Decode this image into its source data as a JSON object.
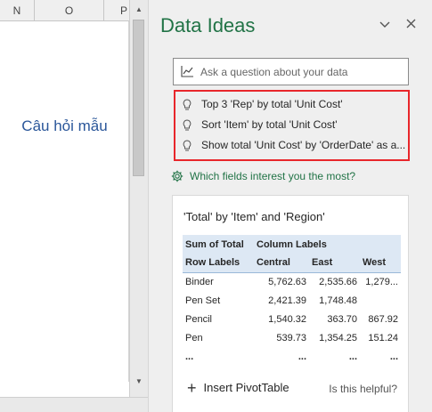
{
  "sheet": {
    "columns": [
      "N",
      "O",
      "P"
    ],
    "center_text": "Câu hỏi mẫu"
  },
  "pane": {
    "title": "Data Ideas",
    "collapse_icon": "chevron-down-icon",
    "close_icon": "close-icon",
    "ask_placeholder": "Ask a question about your data",
    "ask_icon": "chart-line-icon",
    "suggestions": [
      "Top 3 'Rep' by total 'Unit Cost'",
      "Sort 'Item' by total 'Unit Cost'",
      "Show total 'Unit Cost' by 'OrderDate' as a..."
    ],
    "suggestion_icon": "lightbulb-icon",
    "fields_link": "Which fields interest you the most?",
    "fields_icon": "gear-icon",
    "highlight_color": "#e8262b",
    "accent_color": "#217346"
  },
  "card": {
    "title": "'Total' by 'Item' and 'Region'",
    "header_row1": [
      "Sum of Total",
      "Column Labels",
      "",
      ""
    ],
    "header_row2": [
      "Row Labels",
      "Central",
      "East",
      "West"
    ],
    "rows": [
      [
        "Binder",
        "5,762.63",
        "2,535.66",
        "1,279..."
      ],
      [
        "Pen Set",
        "2,421.39",
        "1,748.48",
        ""
      ],
      [
        "Pencil",
        "1,540.32",
        "363.70",
        "867.92"
      ],
      [
        "Pen",
        "539.73",
        "1,354.25",
        "151.24"
      ],
      [
        "...",
        "...",
        "...",
        "..."
      ]
    ],
    "insert_label": "Insert PivotTable",
    "helpful_label": "Is this helpful?"
  }
}
